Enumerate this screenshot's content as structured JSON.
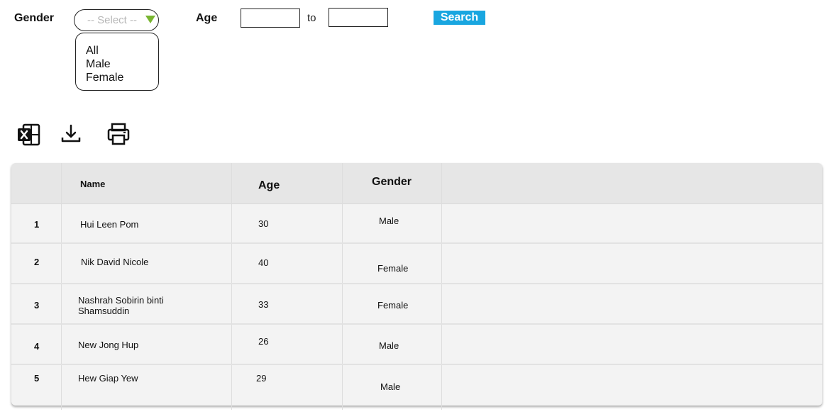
{
  "filters": {
    "gender_label": "Gender",
    "gender_select": {
      "value": "-- Select --",
      "options": [
        "All",
        "Male",
        "Female"
      ]
    },
    "age_label": "Age",
    "age_from": "",
    "age_to": "",
    "to_label": "to",
    "search_label": "Search"
  },
  "toolbar": {
    "icons": [
      "excel-export-icon",
      "download-icon",
      "print-icon"
    ]
  },
  "table": {
    "headers": [
      "Name",
      "Age",
      "Gender"
    ],
    "rows": [
      {
        "no": "1",
        "name": "Hui Leen Pom",
        "age": "30",
        "gender": "Male"
      },
      {
        "no": "2",
        "name": "Nik David Nicole",
        "age": "40",
        "gender": "Female"
      },
      {
        "no": "3",
        "name": "Nashrah Sobirin binti Shamsuddin",
        "age": "33",
        "gender": "Female"
      },
      {
        "no": "4",
        "name": "New Jong Hup",
        "age": "26",
        "gender": "Male"
      },
      {
        "no": "5",
        "name": "Hew Giap Yew",
        "age": "29",
        "gender": "Male"
      }
    ]
  },
  "colors": {
    "accent": "#19a6e0",
    "caret": "#79b531",
    "table_bg": "#f3f3f3",
    "header_bg": "#e6e6e6"
  }
}
